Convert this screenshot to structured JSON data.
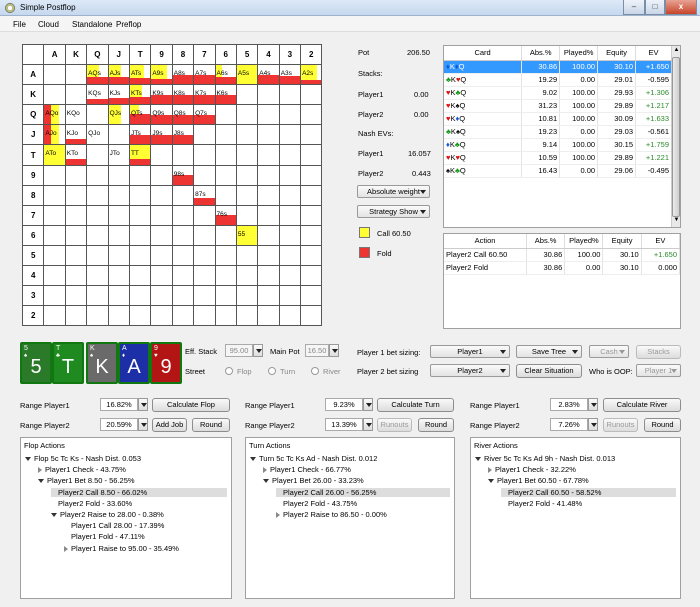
{
  "window": {
    "title": "Simple Postflop",
    "controls": [
      "–",
      "□",
      "x"
    ]
  },
  "menu": [
    "File",
    "Cloud",
    "Standalone",
    "Preflop"
  ],
  "grid": {
    "headers": [
      "",
      "A",
      "K",
      "Q",
      "J",
      "T",
      "9",
      "8",
      "7",
      "6",
      "5",
      "4",
      "3",
      "2"
    ],
    "row_labels": [
      "A",
      "K",
      "Q",
      "J",
      "T",
      "9",
      "8",
      "7",
      "6",
      "5",
      "4",
      "3",
      "2"
    ],
    "cells": [
      {
        "r": 0,
        "c": 2,
        "t": "AQs",
        "y": 0.6,
        "rd": 0.4
      },
      {
        "r": 0,
        "c": 3,
        "t": "AJs",
        "y": 0.6,
        "rd": 0.4
      },
      {
        "r": 0,
        "c": 4,
        "t": "ATs",
        "y": 0.7,
        "rd": 0.3
      },
      {
        "r": 0,
        "c": 5,
        "t": "A9s",
        "y": 0.75,
        "rd": 0.25
      },
      {
        "r": 0,
        "c": 6,
        "t": "A8s",
        "y": 0.0,
        "rd": 0.5
      },
      {
        "r": 0,
        "c": 7,
        "t": "A7s",
        "y": 0.0,
        "rd": 0.5
      },
      {
        "r": 0,
        "c": 8,
        "t": "A6s",
        "y": 0.3,
        "rd": 0.4
      },
      {
        "r": 0,
        "c": 9,
        "t": "A5s",
        "y": 1.0,
        "rd": 0.0
      },
      {
        "r": 0,
        "c": 10,
        "t": "A4s",
        "y": 0.0,
        "rd": 0.5
      },
      {
        "r": 0,
        "c": 11,
        "t": "A3s",
        "y": 0.0,
        "rd": 0.45
      },
      {
        "r": 0,
        "c": 12,
        "t": "A2s",
        "y": 0.8,
        "rd": 0.2
      },
      {
        "r": 1,
        "c": 2,
        "t": "KQs",
        "y": 0.0,
        "rd": 0.3
      },
      {
        "r": 1,
        "c": 3,
        "t": "KJs",
        "y": 0.0,
        "rd": 0.35
      },
      {
        "r": 1,
        "c": 4,
        "t": "KTs",
        "y": 0.6,
        "rd": 0.4
      },
      {
        "r": 1,
        "c": 5,
        "t": "K9s",
        "y": 0.0,
        "rd": 0.5
      },
      {
        "r": 1,
        "c": 6,
        "t": "K8s",
        "y": 0.0,
        "rd": 0.5
      },
      {
        "r": 1,
        "c": 7,
        "t": "K7s",
        "y": 0.0,
        "rd": 0.5
      },
      {
        "r": 1,
        "c": 8,
        "t": "K6s",
        "y": 0.0,
        "rd": 0.5
      },
      {
        "r": 2,
        "c": 0,
        "t": "AQo",
        "y": 0.7,
        "rl": 0.3
      },
      {
        "r": 2,
        "c": 1,
        "t": "KQo",
        "y": 0.0,
        "rd": 0.0
      },
      {
        "r": 2,
        "c": 3,
        "t": "QJs",
        "y": 0.6,
        "rd": 0.0
      },
      {
        "r": 2,
        "c": 4,
        "t": "QTs",
        "y": 0.45,
        "rd": 0.55
      },
      {
        "r": 2,
        "c": 5,
        "t": "Q9s",
        "y": 0.0,
        "rd": 0.5
      },
      {
        "r": 2,
        "c": 6,
        "t": "Q8s",
        "y": 0.0,
        "rd": 0.5
      },
      {
        "r": 2,
        "c": 7,
        "t": "Q7s",
        "y": 0.0,
        "rd": 0.5
      },
      {
        "r": 3,
        "c": 0,
        "t": "AJo",
        "y": 0.7,
        "rl": 0.3
      },
      {
        "r": 3,
        "c": 1,
        "t": "KJo",
        "y": 0.0,
        "rd": 0.3
      },
      {
        "r": 3,
        "c": 2,
        "t": "QJo",
        "y": 0.0,
        "rd": 0.0
      },
      {
        "r": 3,
        "c": 4,
        "t": "JTs",
        "y": 0.0,
        "rd": 0.5
      },
      {
        "r": 3,
        "c": 5,
        "t": "J9s",
        "y": 0.0,
        "rd": 0.5
      },
      {
        "r": 3,
        "c": 6,
        "t": "J8s",
        "y": 0.0,
        "rd": 0.5
      },
      {
        "r": 4,
        "c": 0,
        "t": "ATo",
        "y": 1.0,
        "rd": 0.0
      },
      {
        "r": 4,
        "c": 1,
        "t": "KTo",
        "y": 0.0,
        "rd": 0.3
      },
      {
        "r": 4,
        "c": 3,
        "t": "JTo",
        "y": 0.0,
        "rd": 0.0
      },
      {
        "r": 4,
        "c": 4,
        "t": "TT",
        "y": 1.0,
        "rd": 0.3
      },
      {
        "r": 5,
        "c": 6,
        "t": "98s",
        "y": 0.0,
        "rd": 0.5
      },
      {
        "r": 6,
        "c": 7,
        "t": "87s",
        "y": 0.0,
        "rd": 0.35
      },
      {
        "r": 7,
        "c": 8,
        "t": "76s",
        "y": 0.0,
        "rd": 0.5
      },
      {
        "r": 8,
        "c": 9,
        "t": "55",
        "y": 1.0,
        "rd": 0.0
      }
    ]
  },
  "info": {
    "pot_label": "Pot",
    "pot_value": "206.50",
    "stacks_label": "Stacks:",
    "p1_label": "Player1",
    "p1_stack": "0.00",
    "p2_label": "Player2",
    "p2_stack": "0.00",
    "nash_label": "Nash EVs:",
    "p1_ev_label": "Player1",
    "p1_ev": "16.057",
    "p2_ev_label": "Player2",
    "p2_ev": "0.443",
    "weight_select": "Absolute weight",
    "strategy_select": "Strategy Show",
    "legend": [
      {
        "label": "Call 60.50",
        "color": "#ffff33"
      },
      {
        "label": "Fold",
        "color": "#ee3333"
      }
    ]
  },
  "combo_table": {
    "headers": [
      "Card",
      "Abs.%",
      "Played%",
      "Equity",
      "EV"
    ],
    "rows": [
      {
        "s1": "♦",
        "s1c": "#1155dd",
        "r1": "K",
        "s2": "♦",
        "s2c": "#1155dd",
        "r2": "Q",
        "abs": "30.86",
        "played": "100.00",
        "eq": "30.10",
        "ev": "+1.650",
        "sel": true
      },
      {
        "s1": "♣",
        "s1c": "#119911",
        "r1": "K",
        "s2": "♥",
        "s2c": "#dd1111",
        "r2": "Q",
        "abs": "19.29",
        "played": "0.00",
        "eq": "29.01",
        "ev": "-0.595",
        "sel": false
      },
      {
        "s1": "♥",
        "s1c": "#dd1111",
        "r1": "K",
        "s2": "♣",
        "s2c": "#119911",
        "r2": "Q",
        "abs": "9.02",
        "played": "100.00",
        "eq": "29.93",
        "ev": "+1.306",
        "sel": false
      },
      {
        "s1": "♥",
        "s1c": "#dd1111",
        "r1": "K",
        "s2": "♠",
        "s2c": "#000000",
        "r2": "Q",
        "abs": "31.23",
        "played": "100.00",
        "eq": "29.89",
        "ev": "+1.217",
        "sel": false
      },
      {
        "s1": "♥",
        "s1c": "#dd1111",
        "r1": "K",
        "s2": "♦",
        "s2c": "#1155dd",
        "r2": "Q",
        "abs": "10.81",
        "played": "100.00",
        "eq": "30.09",
        "ev": "+1.633",
        "sel": false
      },
      {
        "s1": "♣",
        "s1c": "#119911",
        "r1": "K",
        "s2": "♠",
        "s2c": "#000000",
        "r2": "Q",
        "abs": "19.23",
        "played": "0.00",
        "eq": "29.03",
        "ev": "-0.561",
        "sel": false
      },
      {
        "s1": "♦",
        "s1c": "#1155dd",
        "r1": "K",
        "s2": "♣",
        "s2c": "#119911",
        "r2": "Q",
        "abs": "9.14",
        "played": "100.00",
        "eq": "30.15",
        "ev": "+1.759",
        "sel": false
      },
      {
        "s1": "♥",
        "s1c": "#dd1111",
        "r1": "K",
        "s2": "♥",
        "s2c": "#dd1111",
        "r2": "Q",
        "abs": "10.59",
        "played": "100.00",
        "eq": "29.89",
        "ev": "+1.221",
        "sel": false
      },
      {
        "s1": "♠",
        "s1c": "#000000",
        "r1": "K",
        "s2": "♣",
        "s2c": "#119911",
        "r2": "Q",
        "abs": "16.43",
        "played": "0.00",
        "eq": "29.06",
        "ev": "-0.495",
        "sel": false
      }
    ]
  },
  "action_table": {
    "headers": [
      "Action",
      "Abs.%",
      "Played%",
      "Equity",
      "EV"
    ],
    "rows": [
      {
        "action": "Player2 Call 60.50",
        "abs": "30.86",
        "played": "100.00",
        "eq": "30.10",
        "ev": "+1.650",
        "green": true
      },
      {
        "action": "Player2 Fold",
        "abs": "30.86",
        "played": "0.00",
        "eq": "30.10",
        "ev": "0.000",
        "green": false
      }
    ]
  },
  "board": [
    {
      "rank": "5",
      "suit": "♠",
      "bg": "#2a7a2a"
    },
    {
      "rank": "T",
      "suit": "♣",
      "bg": "#1f8a1f"
    },
    {
      "rank": "K",
      "suit": "♠",
      "bg": "#6a6a6a"
    },
    {
      "rank": "A",
      "suit": "♦",
      "bg": "#1c2fa6"
    },
    {
      "rank": "9",
      "suit": "♥",
      "bg": "#b31515"
    }
  ],
  "settings": {
    "eff_stack_label": "Eff. Stack",
    "eff_stack": "95.00",
    "main_pot_label": "Main Pot",
    "main_pot": "16.50",
    "street_label": "Street",
    "streets": [
      "Flop",
      "Turn",
      "River"
    ],
    "p1_sizing_label": "Player 1 bet sizing:",
    "p1_sizing": "Player1",
    "p2_sizing_label": "Player 2 bet sizing",
    "p2_sizing": "Player2",
    "save_tree": "Save Tree",
    "cash": "Cash",
    "stacks_btn": "Stacks",
    "clear_situation": "Clear Situation",
    "oop_label": "Who is OOP:",
    "oop": "Player 1"
  },
  "ranges": {
    "flop": {
      "r1_label": "Range Player1",
      "r1": "16.82%",
      "r2_label": "Range Player2",
      "r2": "20.59%",
      "calc": "Calculate Flop",
      "add_job": "Add Job",
      "round": "Round"
    },
    "turn": {
      "r1_label": "Range Player1",
      "r1": "9.23%",
      "r2_label": "Range Player2",
      "r2": "13.39%",
      "calc": "Calculate Turn",
      "runouts": "Runouts",
      "round": "Round"
    },
    "river": {
      "r1_label": "Range Player1",
      "r1": "2.83%",
      "r2_label": "Range Player2",
      "r2": "7.26%",
      "calc": "Calculate River",
      "runouts": "Runouts",
      "round": "Round"
    }
  },
  "trees": {
    "flop": {
      "title": "Flop Actions",
      "nodes": [
        {
          "d": 0,
          "open": true,
          "t": "Flop 5c Tc Ks - Nash Dist. 0.053"
        },
        {
          "d": 1,
          "open": false,
          "t": "Player1 Check - 43.75%"
        },
        {
          "d": 1,
          "open": true,
          "t": "Player1 Bet 8.50 - 56.25%"
        },
        {
          "d": 2,
          "leaf": true,
          "hl": true,
          "t": "Player2 Call 8.50 - 66.02%"
        },
        {
          "d": 2,
          "leaf": true,
          "t": "Player2 Fold - 33.60%"
        },
        {
          "d": 2,
          "open": true,
          "t": "Player2 Raise to 28.00 - 0.38%"
        },
        {
          "d": 3,
          "leaf": true,
          "t": "Player1 Call 28.00 - 17.39%"
        },
        {
          "d": 3,
          "leaf": true,
          "t": "Player1 Fold - 47.11%"
        },
        {
          "d": 3,
          "open": false,
          "t": "Player1 Raise to 95.00 - 35.49%"
        }
      ]
    },
    "turn": {
      "title": "Turn Actions",
      "nodes": [
        {
          "d": 0,
          "open": true,
          "t": "Turn 5c Tc Ks Ad - Nash Dist. 0.012"
        },
        {
          "d": 1,
          "open": false,
          "t": "Player1 Check - 66.77%"
        },
        {
          "d": 1,
          "open": true,
          "t": "Player1 Bet 26.00 - 33.23%"
        },
        {
          "d": 2,
          "leaf": true,
          "hl": true,
          "t": "Player2 Call 26.00 - 56.25%"
        },
        {
          "d": 2,
          "leaf": true,
          "t": "Player2 Fold - 43.75%"
        },
        {
          "d": 2,
          "open": false,
          "t": "Player2 Raise to 86.50 - 0.00%"
        }
      ]
    },
    "river": {
      "title": "River Actions",
      "nodes": [
        {
          "d": 0,
          "open": true,
          "t": "River 5c Tc Ks Ad 9h - Nash Dist. 0.013"
        },
        {
          "d": 1,
          "open": false,
          "t": "Player1 Check - 32.22%"
        },
        {
          "d": 1,
          "open": true,
          "t": "Player1 Bet 60.50 - 67.78%"
        },
        {
          "d": 2,
          "leaf": true,
          "hl": true,
          "t": "Player2 Call 60.50 - 58.52%"
        },
        {
          "d": 2,
          "leaf": true,
          "t": "Player2 Fold - 41.48%"
        }
      ]
    }
  }
}
